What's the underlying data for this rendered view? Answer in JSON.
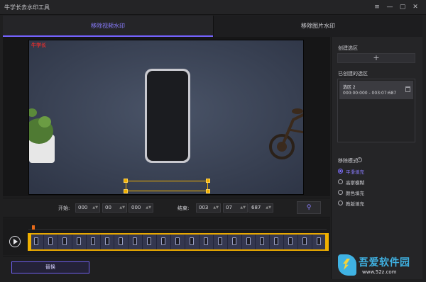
{
  "app": {
    "title": "牛学长去水印工具"
  },
  "window_controls": {
    "menu": "≡",
    "minimize": "—",
    "maximize": "▢",
    "close": "✕"
  },
  "tabs": [
    {
      "label": "移除视频水印",
      "active": true
    },
    {
      "label": "移除图片水印",
      "active": false
    }
  ],
  "video": {
    "watermark_text": "牛学长"
  },
  "controls": {
    "start_label": "开始:",
    "start": {
      "h": "000",
      "m": "00",
      "s": "000"
    },
    "end_label": "结束:",
    "end": {
      "h": "003",
      "m": "07",
      "s": "687"
    }
  },
  "timeline": {
    "frame_count": 21,
    "playhead_fraction": 0.02
  },
  "bottom": {
    "replace_label": "替换"
  },
  "panel": {
    "create_title": "创建选区",
    "add_icon": "+",
    "created_title": "已创建的选区",
    "areas": [
      {
        "name": "选区 2",
        "time": "000:00:000 - 003:07:687"
      }
    ],
    "mode_title": "移除模式",
    "modes": [
      {
        "label": "平滑填充",
        "selected": true
      },
      {
        "label": "高斯模糊",
        "selected": false
      },
      {
        "label": "颜色填充",
        "selected": false
      },
      {
        "label": "教版填充",
        "selected": false
      }
    ]
  },
  "site_watermark": {
    "text": "吾爱软件园",
    "url": "www.52z.com"
  },
  "colors": {
    "accent": "#7563ff",
    "selection": "#f0b000",
    "watermark_red": "#d62f2f"
  }
}
